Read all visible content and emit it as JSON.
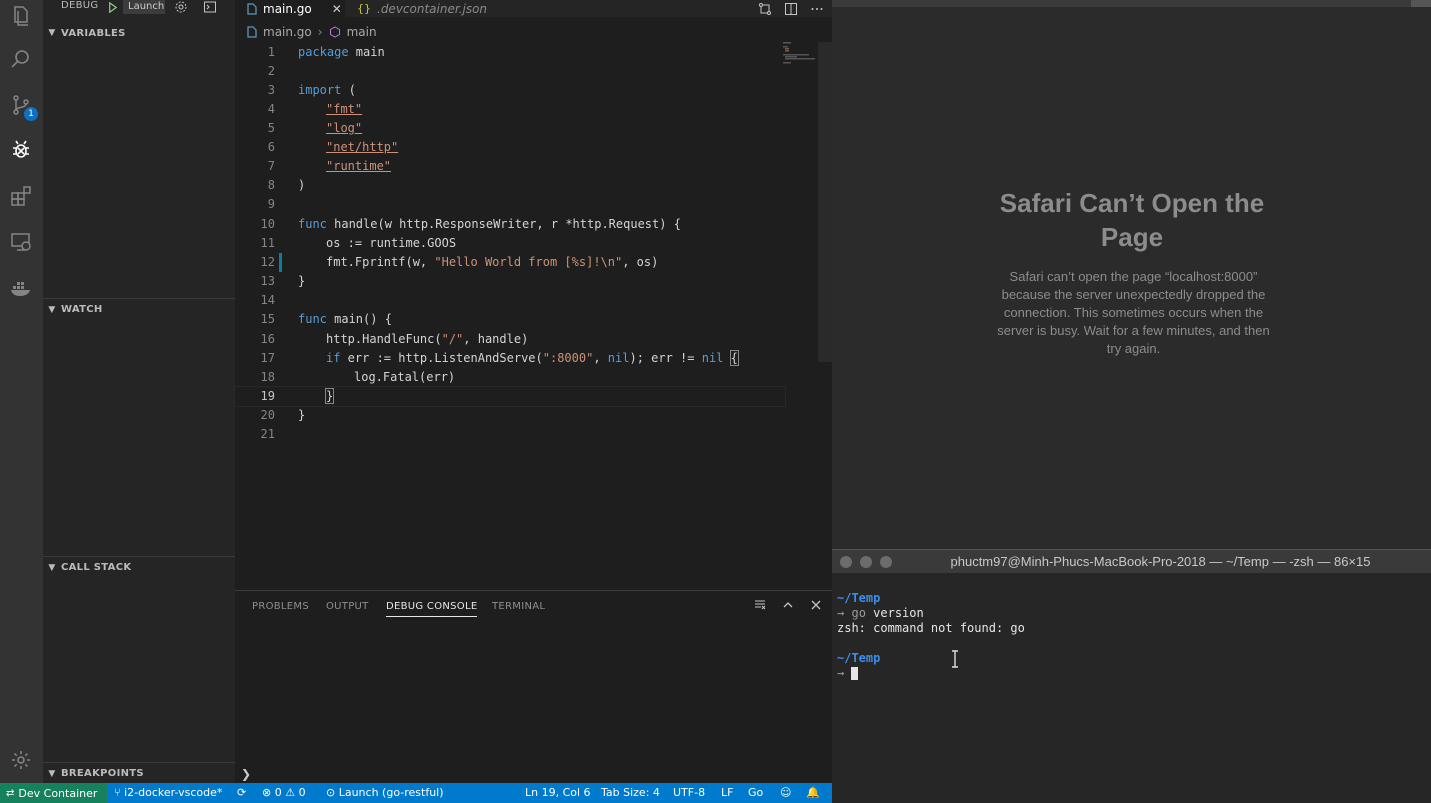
{
  "sidebar": {
    "debug_label": "DEBUG",
    "launch_config": "Launch",
    "sections": [
      "VARIABLES",
      "WATCH",
      "CALL STACK",
      "BREAKPOINTS"
    ]
  },
  "activity": {
    "scm_badge": "1"
  },
  "tabs": [
    {
      "icon": "go-file-icon",
      "label": "main.go",
      "active": true
    },
    {
      "icon": "json-file-icon",
      "label": ".devcontainer.json",
      "active": false
    }
  ],
  "breadcrumb": {
    "file": "main.go",
    "symbol": "main"
  },
  "code": {
    "line_numbers": [
      "1",
      "2",
      "3",
      "4",
      "5",
      "6",
      "7",
      "8",
      "9",
      "10",
      "11",
      "12",
      "13",
      "14",
      "15",
      "16",
      "17",
      "18",
      "19",
      "20",
      "21"
    ],
    "l1": [
      "package",
      " main"
    ],
    "l3": [
      "import",
      " ("
    ],
    "l4": "\"fmt\"",
    "l5": "\"log\"",
    "l6": "\"net/http\"",
    "l7": "\"runtime\"",
    "l8": ")",
    "l10": [
      "func",
      " handle(w http.ResponseWriter, r *http.Request) {"
    ],
    "l11": "os := runtime.GOOS",
    "l12": [
      "fmt.Fprintf(w, ",
      "\"Hello World from [%s]!\\n\"",
      ", os)"
    ],
    "l13": "}",
    "l15": [
      "func",
      " main() {"
    ],
    "l16": [
      "http.HandleFunc(",
      "\"/\"",
      ", handle)"
    ],
    "l17": [
      "if",
      " err := http.ListenAndServe(",
      "\":8000\"",
      ", ",
      "nil",
      "); err != ",
      "nil",
      " ",
      "{"
    ],
    "l18": "log.Fatal(err)",
    "l19": "}",
    "l20": "}"
  },
  "panel": {
    "tabs": [
      "PROBLEMS",
      "OUTPUT",
      "DEBUG CONSOLE",
      "TERMINAL"
    ],
    "active_tab": "DEBUG CONSOLE",
    "prompt": "❯"
  },
  "status": {
    "remote": "Dev Container",
    "branch": "i2-docker-vscode*",
    "errors": "0",
    "warnings": "0",
    "launch": "Launch (go-restful)",
    "position": "Ln 19, Col 6",
    "tab_size": "Tab Size: 4",
    "encoding": "UTF-8",
    "eol": "LF",
    "language": "Go"
  },
  "safari": {
    "title": "Safari Can’t Open the Page",
    "message": "Safari can’t open the page “localhost:8000” because the server unexpectedly dropped the connection. This sometimes occurs when the server is busy. Wait for a few minutes, and then try again."
  },
  "terminal": {
    "title": "phuctm97@Minh-Phucs-MacBook-Pro-2018 — ~/Temp — -zsh — 86×15",
    "dir": "~/Temp",
    "arrow": "→",
    "cmd": "go",
    "arg": " version",
    "output": "zsh: command not found: go"
  }
}
